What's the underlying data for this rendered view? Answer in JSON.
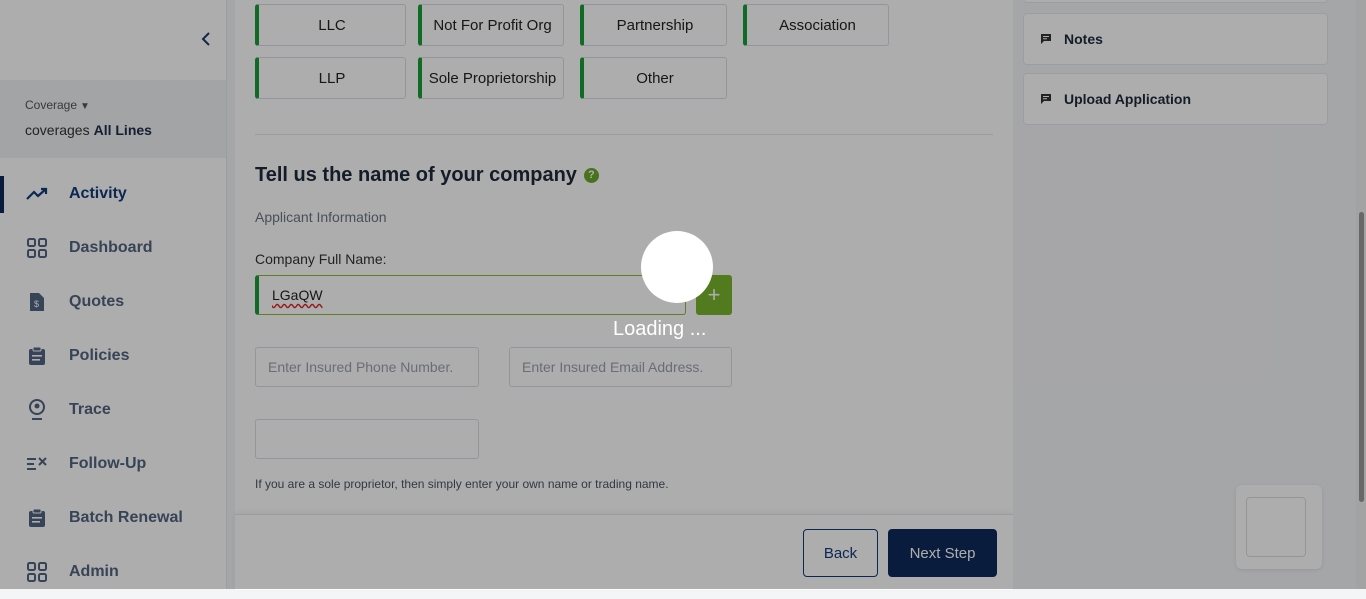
{
  "sidebar": {
    "coverage_label": "Coverage",
    "coverage_img_alt": "coverages",
    "coverage_value": "All Lines",
    "items": [
      {
        "label": "Activity",
        "icon": "trend-icon",
        "active": true
      },
      {
        "label": "Dashboard",
        "icon": "grid-icon"
      },
      {
        "label": "Quotes",
        "icon": "quote-doc-icon"
      },
      {
        "label": "Policies",
        "icon": "clipboard-icon"
      },
      {
        "label": "Trace",
        "icon": "location-pin-icon"
      },
      {
        "label": "Follow-Up",
        "icon": "checklist-icon"
      },
      {
        "label": "Batch Renewal",
        "icon": "clipboard-icon"
      },
      {
        "label": "Admin",
        "icon": "grid-icon"
      }
    ]
  },
  "business_types": [
    "LLC",
    "Not For Profit Org",
    "Partnership",
    "Association",
    "LLP",
    "Sole Proprietorship",
    "Other"
  ],
  "form": {
    "title": "Tell us the name of your company",
    "help": "?",
    "applicant_info": "Applicant Information",
    "company_label": "Company Full Name:",
    "company_value": "LGaQW",
    "add_label": "+",
    "phone_placeholder": "Enter Insured Phone Number.",
    "email_placeholder": "Enter Insured Email Address.",
    "extra_value": "",
    "hint": "If you are a sole proprietor, then simply enter your own name or trading name."
  },
  "footer": {
    "back": "Back",
    "next": "Next Step"
  },
  "right_panel": {
    "notes": "Notes",
    "upload": "Upload Application"
  },
  "loading": {
    "text": "Loading ..."
  },
  "colors": {
    "accent_green": "#1a9e37",
    "navy": "#0f2a5a",
    "add_green": "#7ab52e"
  }
}
